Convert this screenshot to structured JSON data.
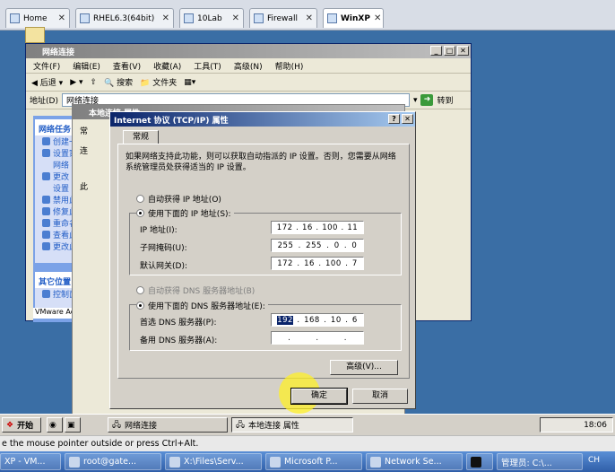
{
  "vmware_tabs": [
    {
      "label": "Home",
      "icon": "home-icon"
    },
    {
      "label": "RHEL6.3(64bit)",
      "icon": "vm-icon"
    },
    {
      "label": "10Lab",
      "icon": "vm-icon"
    },
    {
      "label": "Firewall",
      "icon": "vm-icon"
    },
    {
      "label": "WinXP",
      "icon": "vm-icon",
      "active": true
    }
  ],
  "explorer": {
    "title": "网络连接",
    "menu": [
      "文件(F)",
      "编辑(E)",
      "查看(V)",
      "收藏(A)",
      "工具(T)",
      "高级(N)",
      "帮助(H)"
    ],
    "back": "后退",
    "search": "搜索",
    "folders": "文件夹",
    "address_label": "地址(D)",
    "address_value": "网络连接",
    "go": "转到",
    "tasks_title": "网络任务",
    "tasks": [
      "创建一",
      "设置家",
      "网络",
      "更改",
      "设置",
      "禁用此",
      "修复此",
      "重命名",
      "查看此",
      "更改此"
    ],
    "other_title": "其它位置",
    "other_items": [
      "控制面"
    ],
    "vmware_accel": "VMware Acceler"
  },
  "lan_props": {
    "title": "本地连接 属性",
    "tab_fragment": "常",
    "label_fragment": "连",
    "label_fragment2": "此"
  },
  "tcpip": {
    "title": "Internet 协议 (TCP/IP) 属性",
    "tab": "常规",
    "description": "如果网络支持此功能，则可以获取自动指派的 IP 设置。否则，您需要从网络系统管理员处获得适当的 IP 设置。",
    "auto_ip": "自动获得 IP 地址(O)",
    "use_ip": "使用下面的 IP 地址(S):",
    "ip_label": "IP 地址(I):",
    "ip": [
      "172",
      "16",
      "100",
      "11"
    ],
    "mask_label": "子网掩码(U):",
    "mask": [
      "255",
      "255",
      "0",
      "0"
    ],
    "gw_label": "默认网关(D):",
    "gw": [
      "172",
      "16",
      "100",
      "7"
    ],
    "auto_dns": "自动获得 DNS 服务器地址(B)",
    "use_dns": "使用下面的 DNS 服务器地址(E):",
    "dns1_label": "首选 DNS 服务器(P):",
    "dns1": [
      "192",
      "168",
      "10",
      "6"
    ],
    "dns2_label": "备用 DNS 服务器(A):",
    "advanced": "高级(V)...",
    "ok": "确定",
    "cancel": "取消"
  },
  "guest_taskbar": {
    "start": "开始",
    "items": [
      "网络连接",
      "本地连接 属性"
    ],
    "clock": "18:06"
  },
  "status_text": "e the mouse pointer outside or press Ctrl+Alt.",
  "host_taskbar": [
    "XP - VM...",
    "root@gate...",
    "X:\\Files\\Serv...",
    "Microsoft P...",
    "Network Se...",
    "",
    "管理员: C:\\..."
  ],
  "host_lang": "CH",
  "colors": {
    "desktop": "#3a6ea5",
    "titlebar": "#0a246a",
    "selection": "#0a246a"
  }
}
